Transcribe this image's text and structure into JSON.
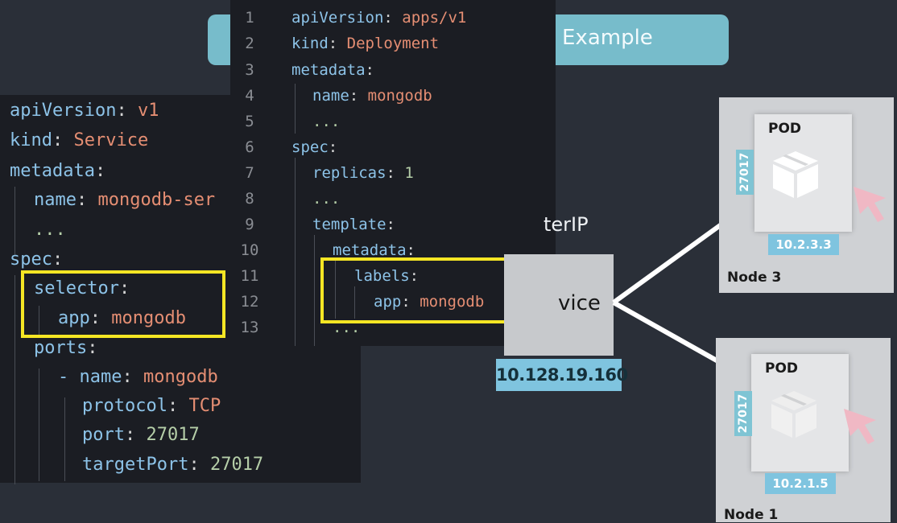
{
  "title": {
    "visible_text": "Example"
  },
  "service_yaml": {
    "lines": [
      {
        "key": "apiVersion",
        "value": "v1"
      },
      {
        "key": "kind",
        "value": "Service"
      },
      {
        "key": "metadata",
        "value": ""
      },
      {
        "key": "name",
        "value": "mongodb-ser"
      },
      {
        "key": "...",
        "value": ""
      },
      {
        "key": "spec",
        "value": ""
      },
      {
        "key": "selector",
        "value": ""
      },
      {
        "key": "app",
        "value": "mongodb"
      },
      {
        "key": "ports",
        "value": ""
      },
      {
        "key": "- name",
        "value": "mongodb"
      },
      {
        "key": "protocol",
        "value": "TCP"
      },
      {
        "key": "port",
        "value": "27017"
      },
      {
        "key": "targetPort",
        "value": "27017"
      }
    ]
  },
  "deployment_yaml": {
    "line_numbers": [
      "1",
      "2",
      "3",
      "4",
      "5",
      "6",
      "7",
      "8",
      "9",
      "10",
      "11",
      "12",
      "13"
    ],
    "lines": [
      {
        "key": "apiVersion",
        "value": "apps/v1"
      },
      {
        "key": "kind",
        "value": "Deployment"
      },
      {
        "key": "metadata",
        "value": ""
      },
      {
        "key": "name",
        "value": "mongodb"
      },
      {
        "key": "...",
        "value": ""
      },
      {
        "key": "spec",
        "value": ""
      },
      {
        "key": "replicas",
        "value": "1"
      },
      {
        "key": "...",
        "value": ""
      },
      {
        "key": "template",
        "value": ""
      },
      {
        "key": "metadata",
        "value": ""
      },
      {
        "key": "labels",
        "value": ""
      },
      {
        "key": "app",
        "value": "mongodb"
      },
      {
        "key": "...",
        "value": ""
      }
    ]
  },
  "service_box": {
    "type_label": "terIP",
    "name_label": "vice",
    "ip": "10.128.19.160"
  },
  "nodes": [
    {
      "name": "Node 3",
      "pod_label": "POD",
      "port": "27017",
      "pod_ip": "10.2.3.3"
    },
    {
      "name": "Node 1",
      "pod_label": "POD",
      "port": "27017",
      "pod_ip": "10.2.1.5"
    }
  ],
  "colors": {
    "background": "#2a2f38",
    "highlight": "#f5e624",
    "accent": "#7fc4df",
    "yaml_key": "#8dc3e8",
    "yaml_string": "#e58e73",
    "yaml_number": "#b5cea8"
  }
}
